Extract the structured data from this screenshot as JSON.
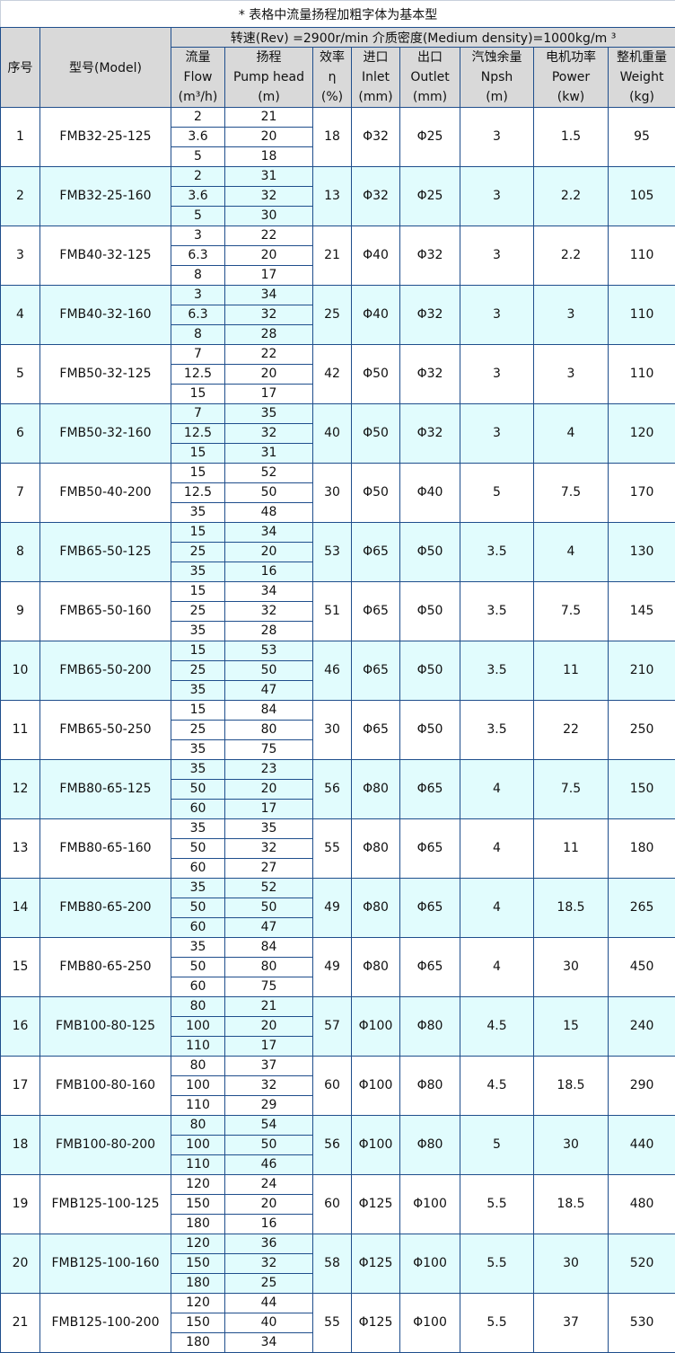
{
  "title": "* 表格中流量扬程加粗字体为基本型",
  "spec_line": "转速(Rev) =2900r/min   介质密度(Medium density)=1000kg/m ³",
  "headers": {
    "num": "序号",
    "model": "型号(Model)",
    "flow": [
      "流量",
      "Flow",
      "(m³/h)"
    ],
    "head": [
      "扬程",
      "Pump head",
      "(m)"
    ],
    "eff": [
      "效率",
      "η",
      "(%)"
    ],
    "inlet": [
      "进口",
      "Inlet",
      "(mm)"
    ],
    "outlet": [
      "出口",
      "Outlet",
      "(mm)"
    ],
    "npsh": [
      "汽蚀余量",
      "Npsh",
      "(m)"
    ],
    "power": [
      "电机功率",
      "Power",
      "(kw)"
    ],
    "weight": [
      "整机重量",
      "Weight",
      "(kg)"
    ]
  },
  "colors": {
    "border": "#1f4e8c",
    "header_bg": "#d9d9d9",
    "alt_row_bg": "#e1fcfd",
    "row_bg": "#ffffff"
  },
  "rows": [
    {
      "num": "1",
      "model": "FMB32-25-125",
      "points": [
        {
          "flow": "2",
          "head": "21",
          "bold": false
        },
        {
          "flow": "3.6",
          "head": "20",
          "bold": true
        },
        {
          "flow": "5",
          "head": "18",
          "bold": false
        }
      ],
      "eff": "18",
      "inlet": "Φ32",
      "outlet": "Φ25",
      "npsh": "3",
      "power": "1.5",
      "weight": "95"
    },
    {
      "num": "2",
      "model": "FMB32-25-160",
      "points": [
        {
          "flow": "2",
          "head": "31",
          "bold": false
        },
        {
          "flow": "3.6",
          "head": "32",
          "bold": true
        },
        {
          "flow": "5",
          "head": "30",
          "bold": false
        }
      ],
      "eff": "13",
      "inlet": "Φ32",
      "outlet": "Φ25",
      "npsh": "3",
      "power": "2.2",
      "weight": "105"
    },
    {
      "num": "3",
      "model": "FMB40-32-125",
      "points": [
        {
          "flow": "3",
          "head": "22",
          "bold": false
        },
        {
          "flow": "6.3",
          "head": "20",
          "bold": true
        },
        {
          "flow": "8",
          "head": "17",
          "bold": false
        }
      ],
      "eff": "21",
      "inlet": "Φ40",
      "outlet": "Φ32",
      "npsh": "3",
      "power": "2.2",
      "weight": "110"
    },
    {
      "num": "4",
      "model": "FMB40-32-160",
      "points": [
        {
          "flow": "3",
          "head": "34",
          "bold": false
        },
        {
          "flow": "6.3",
          "head": "32",
          "bold": true
        },
        {
          "flow": "8",
          "head": "28",
          "bold": false
        }
      ],
      "eff": "25",
      "inlet": "Φ40",
      "outlet": "Φ32",
      "npsh": "3",
      "power": "3",
      "weight": "110"
    },
    {
      "num": "5",
      "model": "FMB50-32-125",
      "points": [
        {
          "flow": "7",
          "head": "22",
          "bold": false
        },
        {
          "flow": "12.5",
          "head": "20",
          "bold": true
        },
        {
          "flow": "15",
          "head": "17",
          "bold": false
        }
      ],
      "eff": "42",
      "inlet": "Φ50",
      "outlet": "Φ32",
      "npsh": "3",
      "power": "3",
      "weight": "110"
    },
    {
      "num": "6",
      "model": "FMB50-32-160",
      "points": [
        {
          "flow": "7",
          "head": "35",
          "bold": false
        },
        {
          "flow": "12.5",
          "head": "32",
          "bold": true
        },
        {
          "flow": "15",
          "head": "31",
          "bold": false
        }
      ],
      "eff": "40",
      "inlet": "Φ50",
      "outlet": "Φ32",
      "npsh": "3",
      "power": "4",
      "weight": "120"
    },
    {
      "num": "7",
      "model": "FMB50-40-200",
      "points": [
        {
          "flow": "15",
          "head": "52",
          "bold": false
        },
        {
          "flow": "12.5",
          "head": "50",
          "bold": true
        },
        {
          "flow": "35",
          "head": "48",
          "bold": false
        }
      ],
      "eff": "30",
      "inlet": "Φ50",
      "outlet": "Φ40",
      "npsh": "5",
      "power": "7.5",
      "weight": "170"
    },
    {
      "num": "8",
      "model": "FMB65-50-125",
      "points": [
        {
          "flow": "15",
          "head": "34",
          "bold": false
        },
        {
          "flow": "25",
          "head": "20",
          "bold": true
        },
        {
          "flow": "35",
          "head": "16",
          "bold": false
        }
      ],
      "eff": "53",
      "inlet": "Φ65",
      "outlet": "Φ50",
      "npsh": "3.5",
      "power": "4",
      "weight": "130"
    },
    {
      "num": "9",
      "model": "FMB65-50-160",
      "points": [
        {
          "flow": "15",
          "head": "34",
          "bold": false
        },
        {
          "flow": "25",
          "head": "32",
          "bold": true
        },
        {
          "flow": "35",
          "head": "28",
          "bold": false
        }
      ],
      "eff": "51",
      "inlet": "Φ65",
      "outlet": "Φ50",
      "npsh": "3.5",
      "power": "7.5",
      "weight": "145"
    },
    {
      "num": "10",
      "model": "FMB65-50-200",
      "points": [
        {
          "flow": "15",
          "head": "53",
          "bold": false
        },
        {
          "flow": "25",
          "head": "50",
          "bold": true
        },
        {
          "flow": "35",
          "head": "47",
          "bold": false
        }
      ],
      "eff": "46",
      "inlet": "Φ65",
      "outlet": "Φ50",
      "npsh": "3.5",
      "power": "11",
      "weight": "210"
    },
    {
      "num": "11",
      "model": "FMB65-50-250",
      "points": [
        {
          "flow": "15",
          "head": "84",
          "bold": false
        },
        {
          "flow": "25",
          "head": "80",
          "bold": true
        },
        {
          "flow": "35",
          "head": "75",
          "bold": false
        }
      ],
      "eff": "30",
      "inlet": "Φ65",
      "outlet": "Φ50",
      "npsh": "3.5",
      "power": "22",
      "weight": "250"
    },
    {
      "num": "12",
      "model": "FMB80-65-125",
      "points": [
        {
          "flow": "35",
          "head": "23",
          "bold": false
        },
        {
          "flow": "50",
          "head": "20",
          "bold": true
        },
        {
          "flow": "60",
          "head": "17",
          "bold": false
        }
      ],
      "eff": "56",
      "inlet": "Φ80",
      "outlet": "Φ65",
      "npsh": "4",
      "power": "7.5",
      "weight": "150"
    },
    {
      "num": "13",
      "model": "FMB80-65-160",
      "points": [
        {
          "flow": "35",
          "head": "35",
          "bold": false
        },
        {
          "flow": "50",
          "head": "32",
          "bold": true
        },
        {
          "flow": "60",
          "head": "27",
          "bold": false
        }
      ],
      "eff": "55",
      "inlet": "Φ80",
      "outlet": "Φ65",
      "npsh": "4",
      "power": "11",
      "weight": "180"
    },
    {
      "num": "14",
      "model": "FMB80-65-200",
      "points": [
        {
          "flow": "35",
          "head": "52",
          "bold": false
        },
        {
          "flow": "50",
          "head": "50",
          "bold": true
        },
        {
          "flow": "60",
          "head": "47",
          "bold": false
        }
      ],
      "eff": "49",
      "inlet": "Φ80",
      "outlet": "Φ65",
      "npsh": "4",
      "power": "18.5",
      "weight": "265"
    },
    {
      "num": "15",
      "model": "FMB80-65-250",
      "points": [
        {
          "flow": "35",
          "head": "84",
          "bold": false
        },
        {
          "flow": "50",
          "head": "80",
          "bold": true
        },
        {
          "flow": "60",
          "head": "75",
          "bold": false
        }
      ],
      "eff": "49",
      "inlet": "Φ80",
      "outlet": "Φ65",
      "npsh": "4",
      "power": "30",
      "weight": "450"
    },
    {
      "num": "16",
      "model": "FMB100-80-125",
      "points": [
        {
          "flow": "80",
          "head": "21",
          "bold": false
        },
        {
          "flow": "100",
          "head": "20",
          "bold": true
        },
        {
          "flow": "110",
          "head": "17",
          "bold": false
        }
      ],
      "eff": "57",
      "inlet": "Φ100",
      "outlet": "Φ80",
      "npsh": "4.5",
      "power": "15",
      "weight": "240"
    },
    {
      "num": "17",
      "model": "FMB100-80-160",
      "points": [
        {
          "flow": "80",
          "head": "37",
          "bold": true
        },
        {
          "flow": "100",
          "head": "32",
          "bold": true
        },
        {
          "flow": "110",
          "head": "29",
          "bold": false
        }
      ],
      "eff": "60",
      "inlet": "Φ100",
      "outlet": "Φ80",
      "npsh": "4.5",
      "power": "18.5",
      "weight": "290"
    },
    {
      "num": "18",
      "model": "FMB100-80-200",
      "points": [
        {
          "flow": "80",
          "head": "54",
          "bold": false
        },
        {
          "flow": "100",
          "head": "50",
          "bold": true
        },
        {
          "flow": "110",
          "head": "46",
          "bold": false
        }
      ],
      "eff": "56",
      "inlet": "Φ100",
      "outlet": "Φ80",
      "npsh": "5",
      "power": "30",
      "weight": "440"
    },
    {
      "num": "19",
      "model": "FMB125-100-125",
      "points": [
        {
          "flow": "120",
          "head": "24",
          "bold": false
        },
        {
          "flow": "150",
          "head": "20",
          "bold": true
        },
        {
          "flow": "180",
          "head": "16",
          "bold": false
        }
      ],
      "eff": "60",
      "inlet": "Φ125",
      "outlet": "Φ100",
      "npsh": "5.5",
      "power": "18.5",
      "weight": "480"
    },
    {
      "num": "20",
      "model": "FMB125-100-160",
      "points": [
        {
          "flow": "120",
          "head": "36",
          "bold": false
        },
        {
          "flow": "150",
          "head": "32",
          "bold": true
        },
        {
          "flow": "180",
          "head": "25",
          "bold": false
        }
      ],
      "eff": "58",
      "inlet": "Φ125",
      "outlet": "Φ100",
      "npsh": "5.5",
      "power": "30",
      "weight": "520"
    },
    {
      "num": "21",
      "model": "FMB125-100-200",
      "points": [
        {
          "flow": "120",
          "head": "44",
          "bold": false
        },
        {
          "flow": "150",
          "head": "40",
          "bold": true
        },
        {
          "flow": "180",
          "head": "34",
          "bold": false
        }
      ],
      "eff": "55",
      "inlet": "Φ125",
      "outlet": "Φ100",
      "npsh": "5.5",
      "power": "37",
      "weight": "530"
    }
  ]
}
